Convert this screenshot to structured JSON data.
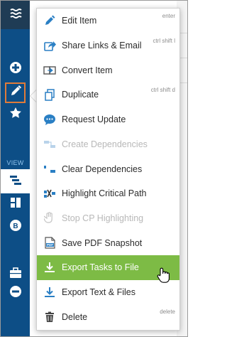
{
  "rail": {
    "menu_icon": "hamburger-icon",
    "view_label": "VIEW",
    "items": [
      {
        "name": "add-icon"
      },
      {
        "name": "edit-icon"
      },
      {
        "name": "star-icon"
      },
      {
        "name": "gantt-view-icon"
      },
      {
        "name": "board-view-icon"
      },
      {
        "name": "b-view-icon"
      },
      {
        "name": "briefcase-icon"
      },
      {
        "name": "minus-circle-icon"
      }
    ]
  },
  "menu": {
    "items": [
      {
        "label": "Edit Item",
        "shortcut": "enter",
        "icon": "pencil-icon",
        "enabled": true
      },
      {
        "label": "Share Links & Email",
        "shortcut": "ctrl shift l",
        "icon": "share-icon",
        "enabled": true
      },
      {
        "label": "Convert Item",
        "shortcut": "",
        "icon": "convert-icon",
        "enabled": true
      },
      {
        "label": "Duplicate",
        "shortcut": "ctrl shift d",
        "icon": "duplicate-icon",
        "enabled": true
      },
      {
        "label": "Request Update",
        "shortcut": "",
        "icon": "chat-bubble-icon",
        "enabled": true
      },
      {
        "label": "Create Dependencies",
        "shortcut": "",
        "icon": "create-dependencies-icon",
        "enabled": false
      },
      {
        "label": "Clear Dependencies",
        "shortcut": "",
        "icon": "clear-dependencies-icon",
        "enabled": true
      },
      {
        "label": "Highlight Critical Path",
        "shortcut": "",
        "icon": "critical-path-icon",
        "enabled": true
      },
      {
        "label": "Stop CP Highlighting",
        "shortcut": "",
        "icon": "hand-icon",
        "enabled": false
      },
      {
        "label": "Save PDF Snapshot",
        "shortcut": "",
        "icon": "pdf-icon",
        "enabled": true
      },
      {
        "label": "Export Tasks to File",
        "shortcut": "",
        "icon": "download-icon",
        "enabled": true,
        "highlighted": true
      },
      {
        "label": "Export Text & Files",
        "shortcut": "",
        "icon": "download-icon",
        "enabled": true
      },
      {
        "label": "Delete",
        "shortcut": "delete",
        "icon": "trash-icon",
        "enabled": true
      }
    ]
  },
  "colors": {
    "rail": "#0d4e86",
    "rail_top": "#1f3c55",
    "accent_icon": "#2a7fc4",
    "highlight": "#7dbb45",
    "edit_outline": "#e07b39"
  }
}
